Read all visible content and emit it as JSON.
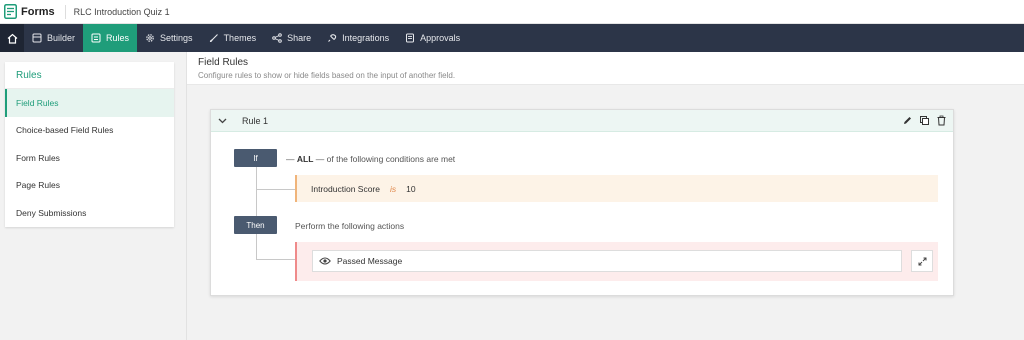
{
  "app": {
    "name": "Forms",
    "form_title": "RLC Introduction Quiz 1"
  },
  "nav": {
    "items": [
      {
        "label": "Builder",
        "icon": "builder-icon"
      },
      {
        "label": "Rules",
        "icon": "rules-icon",
        "active": true
      },
      {
        "label": "Settings",
        "icon": "gear-icon"
      },
      {
        "label": "Themes",
        "icon": "brush-icon"
      },
      {
        "label": "Share",
        "icon": "share-icon"
      },
      {
        "label": "Integrations",
        "icon": "plug-icon"
      },
      {
        "label": "Approvals",
        "icon": "approvals-icon"
      }
    ]
  },
  "sidebar": {
    "title": "Rules",
    "items": [
      {
        "label": "Field Rules",
        "active": true
      },
      {
        "label": "Choice-based Field Rules"
      },
      {
        "label": "Form Rules"
      },
      {
        "label": "Page Rules"
      },
      {
        "label": "Deny Submissions"
      }
    ]
  },
  "main": {
    "title": "Field Rules",
    "subtitle": "Configure rules to show or hide fields based on the input of another field."
  },
  "rule": {
    "name": "Rule 1",
    "if_label": "If",
    "match_prefix": "—",
    "match_type": "ALL",
    "match_suffix": "— of the following conditions are met",
    "condition": {
      "field": "Introduction Score",
      "operator": "is",
      "value": "10"
    },
    "then_label": "Then",
    "then_text": "Perform the following actions",
    "action": {
      "label": "Passed Message",
      "icon": "eye-icon"
    }
  },
  "colors": {
    "accent": "#1f9d7a",
    "nav_bg": "#2c3548",
    "tag_bg": "#4a5a70"
  }
}
